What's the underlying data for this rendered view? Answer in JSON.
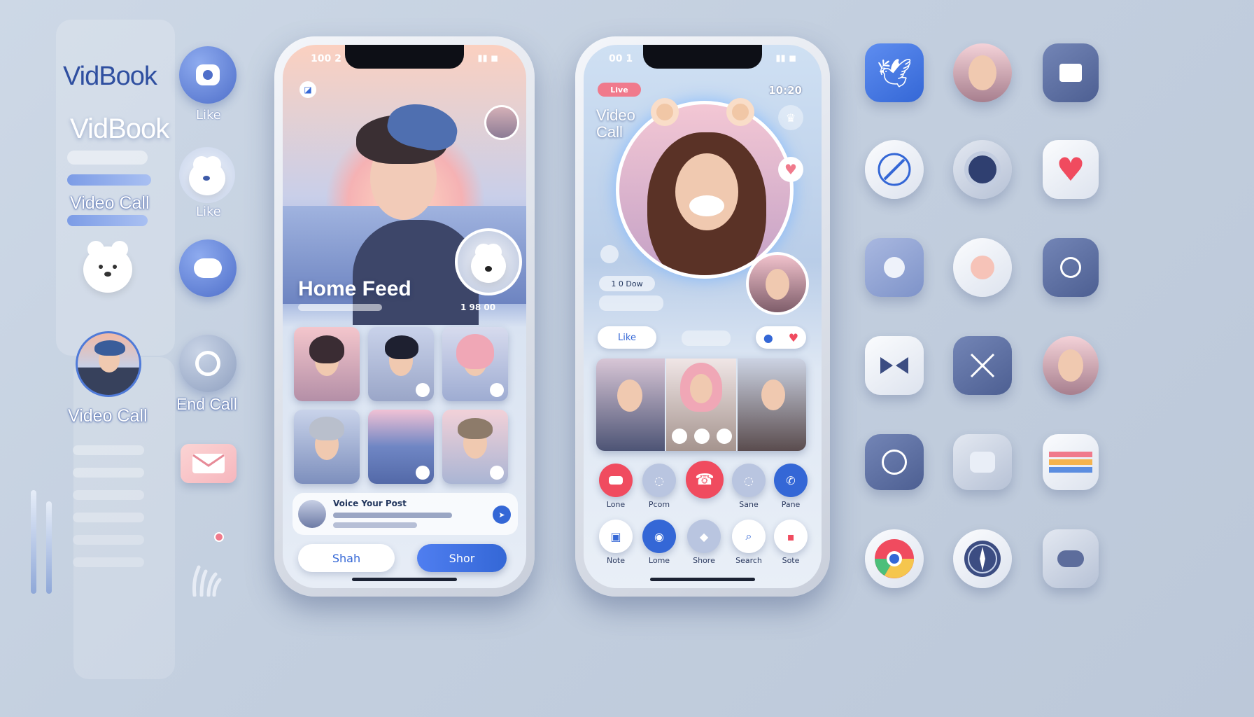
{
  "sidebar": {
    "brand_primary": "VidBook",
    "brand_secondary": "VidBook",
    "video_call_label": "Video Call",
    "video_call_label_2": "Video Call",
    "like_label_1": "Like",
    "like_label_2": "Like",
    "end_call_label": "End Call"
  },
  "phone_left": {
    "status_time": "100 2",
    "feed_title": "Home Feed",
    "feed_count": "1 98 00",
    "post_title": "Voice Your Post",
    "share_left_label": "Shah",
    "share_right_label": "Shor"
  },
  "phone_right": {
    "status_time": "00 1",
    "status_right": "10:20",
    "live_badge": "Live",
    "call_title_line1": "Video",
    "call_title_line2": "Call",
    "stat_pill": "1 0 Dow",
    "like_button": "Like",
    "controls_row1": [
      "Lone",
      "Pcom",
      "",
      "Sane",
      "Pane"
    ],
    "controls_row2": [
      "Note",
      "Lome",
      "Shore",
      "Search",
      "Sote"
    ]
  },
  "colors": {
    "accent_blue": "#3467d6",
    "end_call_red": "#f04b5f",
    "heart_pink": "#f07a8c"
  },
  "icons": [
    "twitter-icon",
    "avatar-icon",
    "camera-icon",
    "compass-icon",
    "gear-icon",
    "heart-icon",
    "pill-icon",
    "chat-icon",
    "wifi-icon",
    "bowtie-icon",
    "close-icon",
    "avatar-icon",
    "clock-icon",
    "puzzle-icon",
    "palette-icon",
    "chrome-icon",
    "safari-icon",
    "cloud-icon"
  ]
}
